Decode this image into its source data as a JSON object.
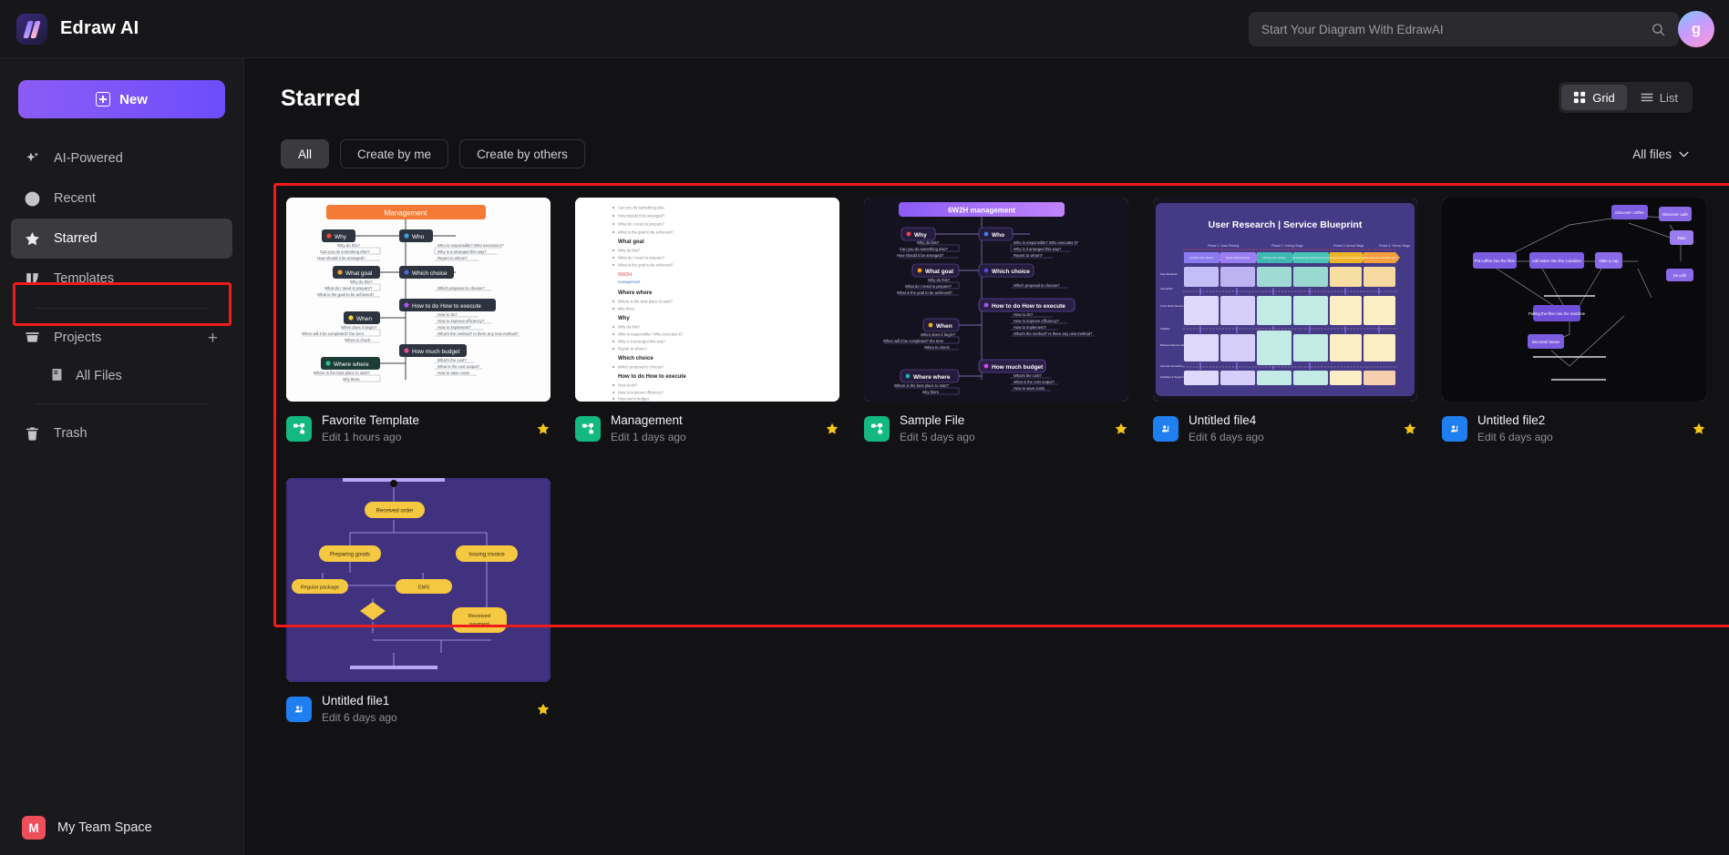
{
  "app": {
    "brand_name": "Edraw AI",
    "logo_icon": "edraw-logo-icon"
  },
  "search": {
    "placeholder": "Start Your Diagram With EdrawAI",
    "value": "",
    "icon": "search-icon"
  },
  "account": {
    "avatar_initial": "g",
    "avatar_icon": "user-avatar"
  },
  "sidebar": {
    "new_button": "New",
    "items": [
      {
        "label": "AI-Powered",
        "icon": "sparkle-icon",
        "active": false
      },
      {
        "label": "Recent",
        "icon": "clock-icon",
        "active": false
      },
      {
        "label": "Starred",
        "icon": "star-icon",
        "active": true
      },
      {
        "label": "Templates",
        "icon": "templates-icon",
        "active": false
      }
    ],
    "projects": {
      "label": "Projects",
      "icon": "folder-icon",
      "add_icon": "plus-icon",
      "children": [
        {
          "label": "All Files",
          "icon": "files-icon"
        }
      ]
    },
    "trash": {
      "label": "Trash",
      "icon": "trash-icon"
    },
    "team_space": {
      "label": "My Team Space",
      "badge": "M",
      "badge_color": "#ef4f5a"
    }
  },
  "main": {
    "page_title": "Starred",
    "filters": [
      {
        "label": "All",
        "active": true
      },
      {
        "label": "Create by me",
        "active": false
      },
      {
        "label": "Create by others",
        "active": false
      }
    ],
    "all_files_dropdown": {
      "label": "All files",
      "icon": "chevron-down-icon"
    },
    "view_toggle": [
      {
        "label": "Grid",
        "icon": "grid-icon",
        "active": true
      },
      {
        "label": "List",
        "icon": "list-icon",
        "active": false
      }
    ]
  },
  "files": [
    {
      "name": "Favorite Template",
      "time": "Edit 1 hours ago",
      "icon": "diagram-file-icon",
      "icon_color": "green",
      "starred": true,
      "thumb": "mindmap-light",
      "thumb_title": "Management"
    },
    {
      "name": "Management",
      "time": "Edit 1 days ago",
      "icon": "diagram-file-icon",
      "icon_color": "green",
      "starred": true,
      "thumb": "outline-light",
      "thumb_title": ""
    },
    {
      "name": "Sample File",
      "time": "Edit 5 days ago",
      "icon": "diagram-file-icon",
      "icon_color": "green",
      "starred": true,
      "thumb": "mindmap-dark",
      "thumb_title": "6W2H management"
    },
    {
      "name": "Untitled file4",
      "time": "Edit 6 days ago",
      "icon": "whiteboard-file-icon",
      "icon_color": "blue",
      "starred": true,
      "thumb": "blueprint",
      "thumb_title": "User Research | Service Blueprint"
    },
    {
      "name": "Untitled file2",
      "time": "Edit 6 days ago",
      "icon": "whiteboard-file-icon",
      "icon_color": "blue",
      "starred": true,
      "thumb": "network-dark",
      "thumb_title": ""
    },
    {
      "name": "Untitled file1",
      "time": "Edit 6 days ago",
      "icon": "whiteboard-file-icon",
      "icon_color": "blue",
      "starred": true,
      "thumb": "flowchart-purple",
      "thumb_title": ""
    }
  ],
  "thumb_content": {
    "mindmap_root": "Management",
    "mindmap_dark_root": "6W2H management",
    "branches_left": [
      "Why",
      "What goal",
      "When",
      "Where where"
    ],
    "branches_right": [
      "Who",
      "Which choice",
      "How to do How to execute",
      "How much budget"
    ],
    "why_items": [
      "Why do this?",
      "Can you do something else?",
      "How should it be arranged?"
    ],
    "who_items": [
      "Who is responsible? Who executes it?",
      "Why is it arranged this way?",
      "Report to whom?"
    ],
    "whatgoal_items": [
      "Why do this?",
      "What do I need to prepare?",
      "What is the goal to be achieved?"
    ],
    "whichchoice_items": [
      "Which proposal to choose?"
    ],
    "when_items": [
      "When does it begin?",
      "When will it be completed? the term",
      "When to check"
    ],
    "howto_items": [
      "How to do?",
      "How to improve efficiency?",
      "How to implement?",
      "What's the method? Is there any new method?"
    ],
    "where_items": [
      "Where is the best place to start?",
      "why there"
    ],
    "budget_items": [
      "What's the cost?",
      "What is the cost output?",
      "How to save costs"
    ],
    "blueprint_title": "User Research | Service Blueprint",
    "flowchart_nodes": [
      "Received order",
      "Preparing goods",
      "Issuing invoice",
      "Regular package",
      "EMS",
      "Received payment"
    ],
    "network_labels": [
      "Discover coffee",
      "Discover cafe",
      "Put coffee into the filter",
      "Add water into the container",
      "Take a cup",
      "Pulling the filter into the machine",
      "No cafe",
      "Decorate beans"
    ]
  },
  "highlights": {
    "sidebar_starred_color": "#f01b1b",
    "grid_area_color": "#f01b1b"
  }
}
